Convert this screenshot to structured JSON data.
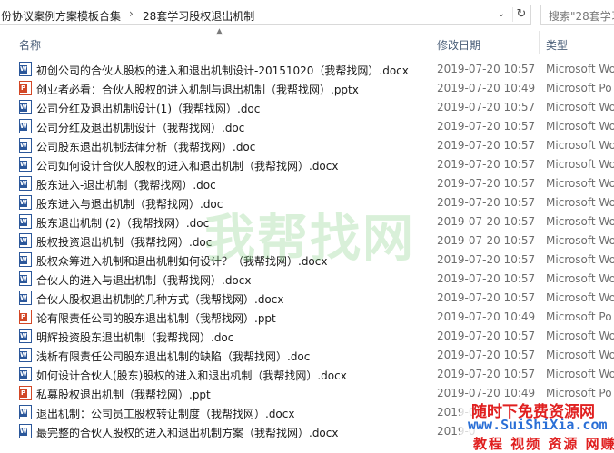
{
  "address": {
    "crumbs": [
      "份协议案例方案模板合集",
      "28套学习股权退出机制"
    ],
    "separator": "›",
    "search_placeholder": "搜索\"28套学习..."
  },
  "columns": {
    "name": "名称",
    "date": "修改日期",
    "type": "类型"
  },
  "files": [
    {
      "icon": "word",
      "name": "初创公司的合伙人股权的进入和退出机制设计-20151020（我帮找网）.docx",
      "date": "2019-07-20 10:57",
      "type": "Microsoft Wo"
    },
    {
      "icon": "ppt",
      "name": "创业者必看：合伙人股权的进入机制与退出机制（我帮找网）.pptx",
      "date": "2019-07-20 10:49",
      "type": "Microsoft Po"
    },
    {
      "icon": "word",
      "name": "公司分红及退出机制设计(1)（我帮找网）.doc",
      "date": "2019-07-20 10:57",
      "type": "Microsoft Wo"
    },
    {
      "icon": "word",
      "name": "公司分红及退出机制设计（我帮找网）.doc",
      "date": "2019-07-20 10:57",
      "type": "Microsoft Wo"
    },
    {
      "icon": "word",
      "name": "公司股东退出机制法律分析（我帮找网）.doc",
      "date": "2019-07-20 10:57",
      "type": "Microsoft Wo"
    },
    {
      "icon": "word",
      "name": "公司如何设计合伙人股权的进入和退出机制（我帮找网）.docx",
      "date": "2019-07-20 10:57",
      "type": "Microsoft Wo"
    },
    {
      "icon": "word",
      "name": "股东进入-退出机制（我帮找网）.doc",
      "date": "2019-07-20 10:57",
      "type": "Microsoft Wo"
    },
    {
      "icon": "word",
      "name": "股东进入与退出机制（我帮找网）.doc",
      "date": "2019-07-20 10:57",
      "type": "Microsoft Wo"
    },
    {
      "icon": "word",
      "name": "股东退出机制 (2)（我帮找网）.doc",
      "date": "2019-07-20 10:57",
      "type": "Microsoft Wo"
    },
    {
      "icon": "word",
      "name": "股权投资退出机制（我帮找网）.doc",
      "date": "2019-07-20 10:57",
      "type": "Microsoft Wo"
    },
    {
      "icon": "word",
      "name": "股权众筹进入机制和退出机制如何设计？（我帮找网）.docx",
      "date": "2019-07-20 10:57",
      "type": "Microsoft Wo"
    },
    {
      "icon": "word",
      "name": "合伙人的进入与退出机制（我帮找网）.docx",
      "date": "2019-07-20 10:57",
      "type": "Microsoft Wo"
    },
    {
      "icon": "word",
      "name": "合伙人股权退出机制的几种方式（我帮找网）.docx",
      "date": "2019-07-20 10:57",
      "type": "Microsoft Wo"
    },
    {
      "icon": "ppt",
      "name": "论有限责任公司的股东退出机制（我帮找网）.ppt",
      "date": "2019-07-20 10:49",
      "type": "Microsoft Po"
    },
    {
      "icon": "word",
      "name": "明辉投资股东退出机制（我帮找网）.doc",
      "date": "2019-07-20 10:57",
      "type": "Microsoft Wo"
    },
    {
      "icon": "word",
      "name": "浅析有限责任公司股东退出机制的缺陷（我帮找网）.doc",
      "date": "2019-07-20 10:57",
      "type": "Microsoft Wo"
    },
    {
      "icon": "word",
      "name": "如何设计合伙人(股东)股权的进入和退出机制（我帮找网）.docx",
      "date": "2019-07-20 10:57",
      "type": "Microsoft Wo"
    },
    {
      "icon": "ppt",
      "name": "私募股权退出机制（我帮找网）.ppt",
      "date": "2019-07-20 10:49",
      "type": "Microsoft Po"
    },
    {
      "icon": "word",
      "name": "退出机制：公司员工股权转让制度（我帮找网）.docx",
      "date": "2019-0",
      "type": ""
    },
    {
      "icon": "word",
      "name": "最完整的合伙人股权的进入和退出机制方案（我帮找网）.docx",
      "date": "2019-0",
      "type": ""
    }
  ],
  "watermarks": {
    "center": "我帮找网",
    "corner_line1": "随时下免费资源网",
    "corner_line2": "www.SuiShiXia.com",
    "corner_line3": "教程 视频 资源 网赚"
  }
}
